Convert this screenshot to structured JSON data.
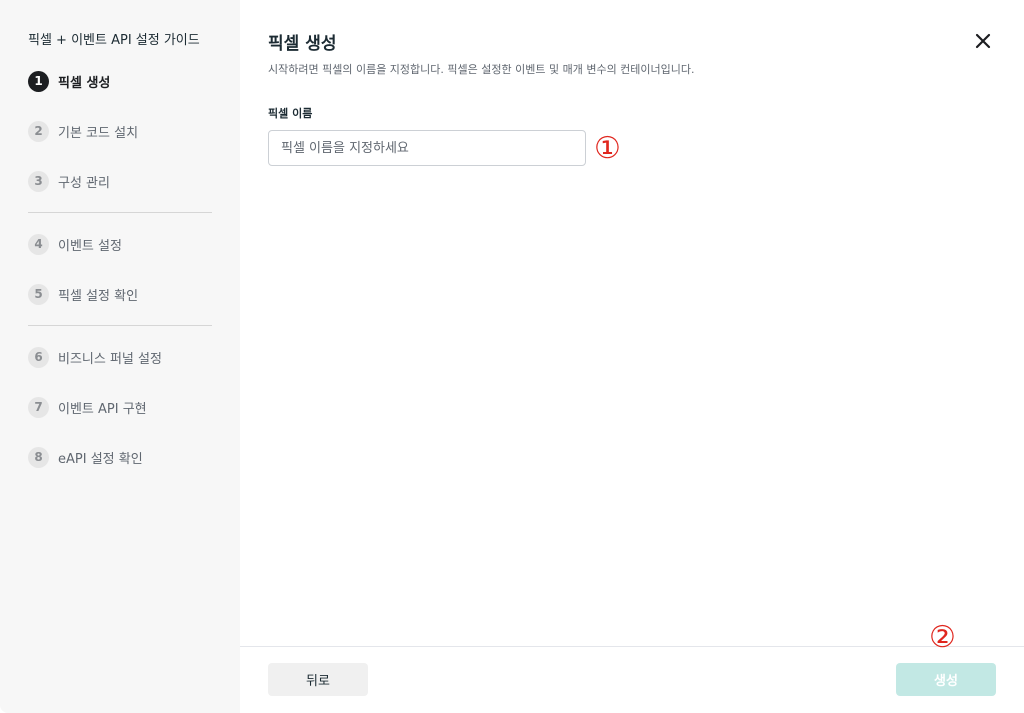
{
  "sidebar": {
    "title": "픽셀 + 이벤트 API 설정 가이드",
    "steps": [
      {
        "num": "1",
        "label": "픽셀 생성",
        "active": true
      },
      {
        "num": "2",
        "label": "기본 코드 설치"
      },
      {
        "num": "3",
        "label": "구성 관리"
      },
      {
        "num": "4",
        "label": "이벤트 설정"
      },
      {
        "num": "5",
        "label": "픽셀 설정 확인"
      },
      {
        "num": "6",
        "label": "비즈니스 퍼널 설정"
      },
      {
        "num": "7",
        "label": "이벤트 API 구현"
      },
      {
        "num": "8",
        "label": "eAPI 설정 확인"
      }
    ]
  },
  "main": {
    "title": "픽셀 생성",
    "subtitle": "시작하려면 픽셀의 이름을 지정합니다. 픽셀은 설정한 이벤트 및 매개 변수의 컨테이너입니다.",
    "field_label": "픽셀 이름",
    "input_value": "",
    "input_placeholder": "픽셀 이름을 지정하세요"
  },
  "footer": {
    "back_label": "뒤로",
    "create_label": "생성"
  },
  "annotations": {
    "marker_1": "①",
    "marker_2": "②"
  },
  "icons": {
    "close": "close-icon"
  },
  "colors": {
    "active_step": "#1c1e21",
    "create_button_disabled": "#c2e8e4",
    "annotation": "#e0271f"
  }
}
